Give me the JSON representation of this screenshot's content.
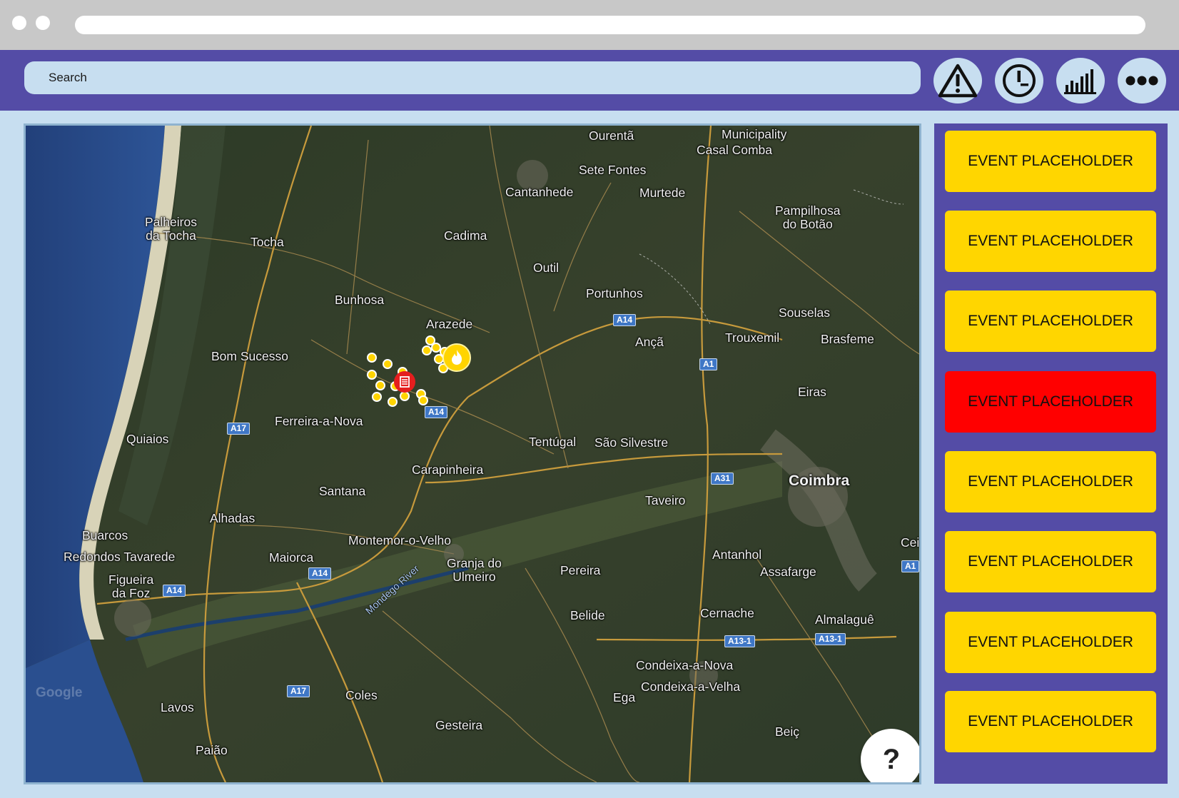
{
  "toolbar": {
    "search_placeholder": "Search",
    "buttons": [
      "warning-icon",
      "clock-icon",
      "chart-icon",
      "more-icon"
    ]
  },
  "map": {
    "places": {
      "ourenta": "Ourentã",
      "municipality": "Municipality",
      "casal_comba": "Casal Comba",
      "sete_fontes": "Sete Fontes",
      "cantanhede": "Cantanhede",
      "murtede": "Murtede",
      "pampilhosa": "Pampilhosa\ndo Botão",
      "palheiros": "Palheiros\nda Tocha",
      "tocha": "Tocha",
      "cadima": "Cadima",
      "outil": "Outil",
      "portunhos": "Portunhos",
      "bunhosa": "Bunhosa",
      "arazede": "Arazede",
      "souselas": "Souselas",
      "anca": "Ançã",
      "trouxemil": "Trouxemil",
      "brasfeme": "Brasfeme",
      "bom_sucesso": "Bom Sucesso",
      "eiras": "Eiras",
      "ferreira": "Ferreira-a-Nova",
      "quiaios": "Quiaios",
      "tentugal": "Tentúgal",
      "sao_silvestre": "São Silvestre",
      "carapinheira": "Carapinheira",
      "coimbra": "Coimbra",
      "santana": "Santana",
      "taveiro": "Taveiro",
      "alhadas": "Alhadas",
      "buarcos": "Buarcos",
      "montemor": "Montemor-o-Velho",
      "cei": "Cei",
      "redondos": "Redondos Tavarede",
      "maiorca": "Maiorca",
      "antanhol": "Antanhol",
      "granja": "Granja do\nUlmeiro",
      "pereira": "Pereira",
      "assafarge": "Assafarge",
      "figueira": "Figueira\nda Foz",
      "belide": "Belide",
      "cernache": "Cernache",
      "almalague": "Almalaguê",
      "condeixa_nova": "Condeixa-a-Nova",
      "condeixa_velha": "Condeixa-a-Velha",
      "ega": "Ega",
      "coles": "Coles",
      "lavos": "Lavos",
      "gesteira": "Gesteira",
      "beica": "Beiç",
      "paiao": "Paião"
    },
    "river_label": "Mondego River",
    "roads": {
      "a14_1": "A14",
      "a1": "A1",
      "a14_2": "A14",
      "a17_1": "A17",
      "a31": "A31",
      "a14_3": "A14",
      "a14_4": "A14",
      "a14_edge": "A1",
      "a13_1": "A13-1",
      "a13_2": "A13-1",
      "a17_2": "A17"
    },
    "watermark": "Google",
    "help_label": "?"
  },
  "events": [
    {
      "label": "EVENT PLACEHOLDER",
      "color": "#ffd600"
    },
    {
      "label": "EVENT PLACEHOLDER",
      "color": "#ffd600"
    },
    {
      "label": "EVENT PLACEHOLDER",
      "color": "#ffd600"
    },
    {
      "label": "EVENT PLACEHOLDER",
      "color": "#ff0000"
    },
    {
      "label": "EVENT PLACEHOLDER",
      "color": "#ffd600"
    },
    {
      "label": "EVENT PLACEHOLDER",
      "color": "#ffd600"
    },
    {
      "label": "EVENT PLACEHOLDER",
      "color": "#ffd600"
    },
    {
      "label": "EVENT PLACEHOLDER",
      "color": "#ffd600"
    }
  ],
  "colors": {
    "accent": "#544ca6",
    "background": "#c7def0",
    "event_default": "#ffd600",
    "event_alert": "#ff0000",
    "marker": "#ffd400"
  }
}
